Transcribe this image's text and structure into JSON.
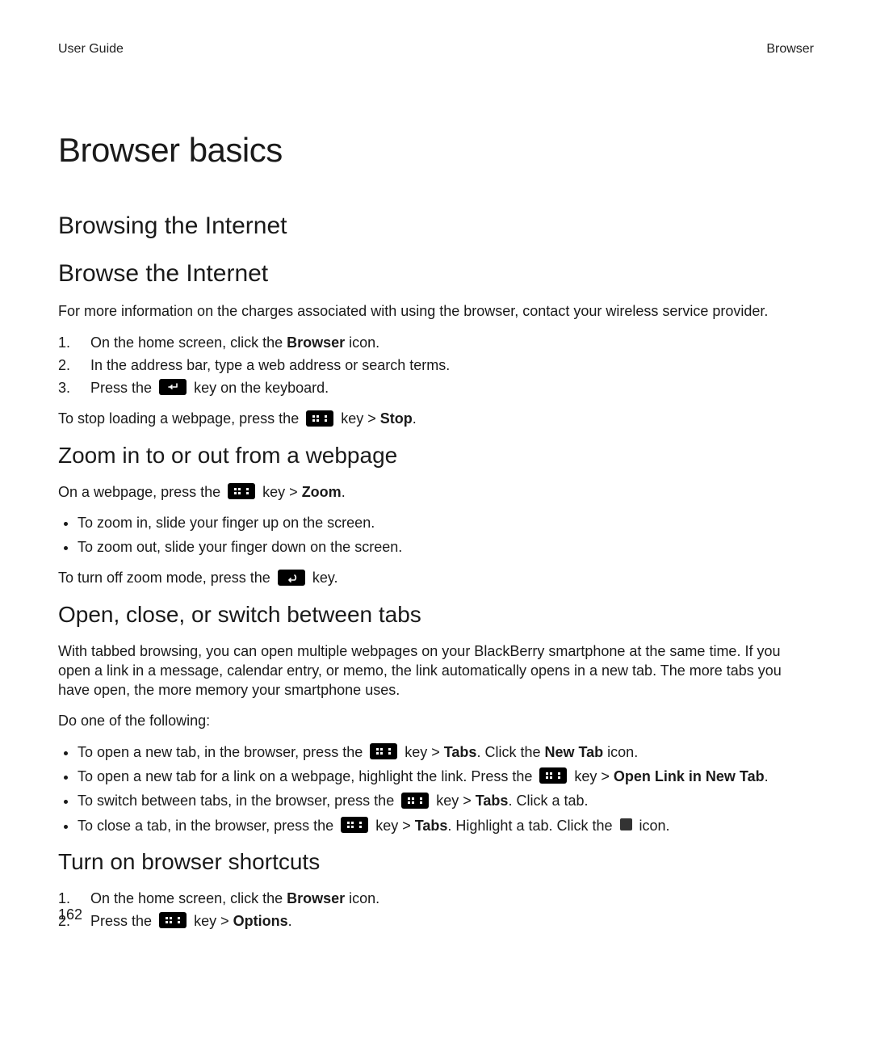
{
  "header": {
    "left": "User Guide",
    "right": "Browser"
  },
  "title": "Browser basics",
  "section1": {
    "heading": "Browsing the Internet",
    "sub1": {
      "heading": "Browse the Internet",
      "intro": "For more information on the charges associated with using the browser, contact your wireless service provider.",
      "steps": {
        "s1a": "On the home screen, click the ",
        "s1b_bold": "Browser",
        "s1c": " icon.",
        "s2": "In the address bar, type a web address or search terms.",
        "s3a": "Press the ",
        "s3b": " key on the keyboard."
      },
      "stop_a": "To stop loading a webpage, press the ",
      "stop_b": " key > ",
      "stop_bold": "Stop",
      "stop_c": "."
    },
    "sub2": {
      "heading": "Zoom in to or out from a webpage",
      "intro_a": "On a webpage, press the ",
      "intro_b": " key > ",
      "intro_bold": "Zoom",
      "intro_c": ".",
      "bullets": {
        "b1": "To zoom in, slide your finger up on the screen.",
        "b2": "To zoom out, slide your finger down on the screen."
      },
      "off_a": "To turn off zoom mode, press the ",
      "off_b": " key."
    },
    "sub3": {
      "heading": "Open, close, or switch between tabs",
      "para": "With tabbed browsing, you can open multiple webpages on your BlackBerry smartphone at the same time. If you open a link in a message, calendar entry, or memo, the link automatically opens in a new tab. The more tabs you have open, the more memory your smartphone uses.",
      "lead": "Do one of the following:",
      "b1_a": "To open a new tab, in the browser, press the ",
      "b1_b": " key > ",
      "b1_bold1": "Tabs",
      "b1_c": ". Click the ",
      "b1_bold2": "New Tab",
      "b1_d": " icon.",
      "b2_a": "To open a new tab for a link on a webpage, highlight the link. Press the ",
      "b2_b": " key > ",
      "b2_bold": "Open Link in New Tab",
      "b2_c": ".",
      "b3_a": "To switch between tabs, in the browser, press the ",
      "b3_b": " key > ",
      "b3_bold": "Tabs",
      "b3_c": ". Click a tab.",
      "b4_a": "To close a tab, in the browser, press the ",
      "b4_b": " key > ",
      "b4_bold": "Tabs",
      "b4_c": ". Highlight a tab. Click the ",
      "b4_d": " icon."
    },
    "sub4": {
      "heading": "Turn on browser shortcuts",
      "s1a": "On the home screen, click the ",
      "s1b_bold": "Browser",
      "s1c": " icon.",
      "s2a": "Press the ",
      "s2b": " key > ",
      "s2_bold": "Options",
      "s2c": "."
    }
  },
  "page_number": "162",
  "icons": {
    "bb": "blackberry-menu-icon",
    "enter": "enter-key-icon",
    "back": "back-key-icon",
    "close": "close-icon"
  }
}
